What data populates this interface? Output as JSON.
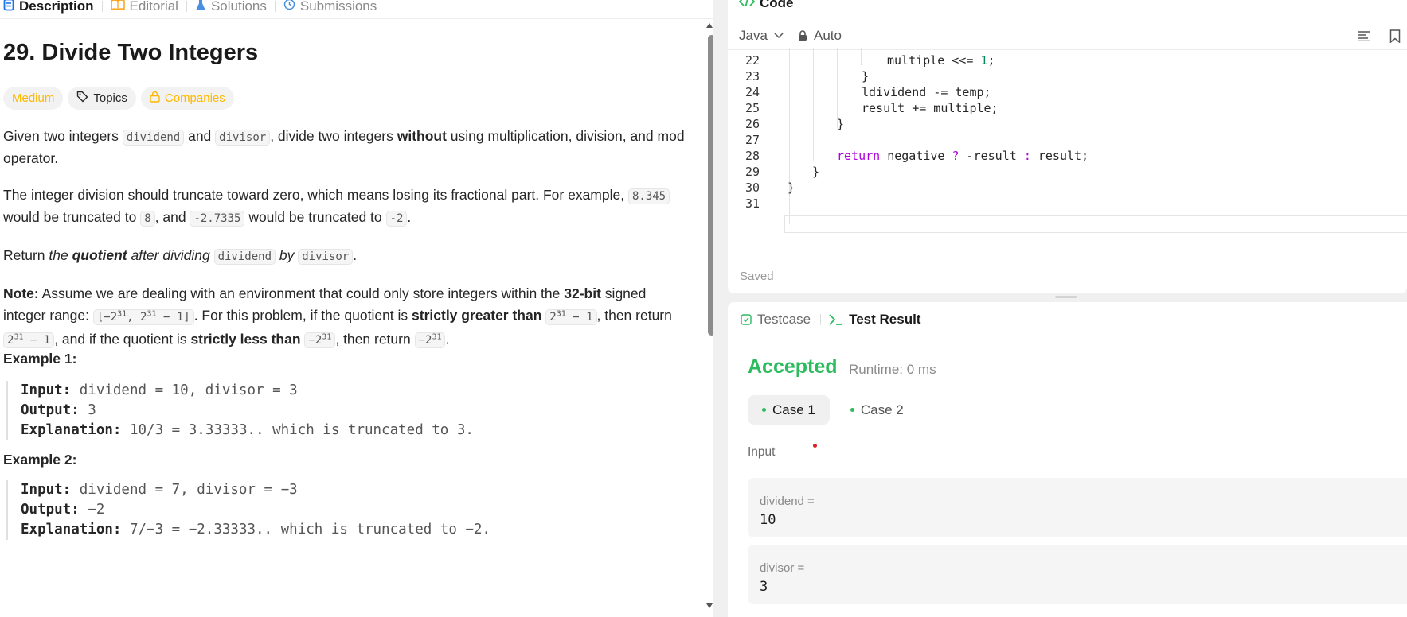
{
  "left_tabs": [
    {
      "label": "Description",
      "icon": "document-icon"
    },
    {
      "label": "Editorial",
      "icon": "book-icon"
    },
    {
      "label": "Solutions",
      "icon": "flask-icon"
    },
    {
      "label": "Submissions",
      "icon": "history-icon"
    }
  ],
  "problem": {
    "title": "29. Divide Two Integers",
    "difficulty": "Medium",
    "topics": "Topics",
    "companies": "Companies",
    "difficulty_color": "#ffb800"
  },
  "desc": {
    "p1": {
      "a": "Given two integers ",
      "c1": "dividend",
      "b": " and ",
      "c2": "divisor",
      "d": ", divide two integers ",
      "bold": "without",
      "e": " using multiplication, division, and mod operator."
    },
    "p2": {
      "a": "The integer division should truncate toward zero, which means losing its fractional part. For example, ",
      "c1": "8.345",
      "b": " would be truncated to ",
      "c2": "8",
      "d": ", and ",
      "c3": "-2.7335",
      "e": " would be truncated to ",
      "c4": "-2",
      "f": "."
    },
    "p3": {
      "a": "Return ",
      "i1": "the ",
      "bi": "quotient",
      "i2": " after dividing ",
      "c1": "dividend",
      "i3": " by ",
      "c2": "divisor",
      "f": "."
    },
    "p4": {
      "note": "Note:",
      "a": " Assume we are dealing with an environment that could only store integers within the ",
      "b32": "32-bit",
      "b": " signed integer range: ",
      "range_open": "[−2",
      "exp": "31",
      "range_mid": ", 2",
      "range_close": " − 1]",
      "c": ". For this problem, if the quotient is ",
      "sg": "strictly greater than",
      "two": "2",
      "minus_one": " − 1",
      "d": ", then return ",
      "e": ", and if the quotient is ",
      "sl": "strictly less than",
      "neg_two": "−2",
      "f": ", then return ",
      "end": "."
    }
  },
  "examples": [
    {
      "heading": "Example 1:",
      "input_k": "Input:",
      "input_v": " dividend = 10, divisor = 3",
      "output_k": "Output:",
      "output_v": " 3",
      "expl_k": "Explanation:",
      "expl_v": " 10/3 = 3.33333.. which is truncated to 3."
    },
    {
      "heading": "Example 2:",
      "input_k": "Input:",
      "input_v": " dividend = 7, divisor = −3",
      "output_k": "Output:",
      "output_v": " −2",
      "expl_k": "Explanation:",
      "expl_v": " 7/−3 = −2.33333.. which is truncated to −2."
    }
  ],
  "code": {
    "header": "Code",
    "language": "Java",
    "auto": "Auto",
    "saved": "Saved",
    "line_numbers": [
      "22",
      "23",
      "24",
      "25",
      "26",
      "27",
      "28",
      "29",
      "30",
      "31"
    ],
    "lines": [
      {
        "plain": "multiple <<= ",
        "num": "1",
        "tail": ";"
      },
      {
        "plain": "}"
      },
      {
        "plain": "ldividend -= temp;"
      },
      {
        "plain": "result += multiple;"
      },
      {
        "plain": "}"
      },
      {
        "plain": ""
      },
      {
        "kw": "return",
        "plain": " negative ",
        "kw2": "?",
        "plain2": " -result ",
        "kw3": ":",
        "plain3": " result;"
      },
      {
        "plain": "}"
      },
      {
        "plain": "}"
      },
      {
        "plain": ""
      }
    ]
  },
  "result": {
    "tab_testcase": "Testcase",
    "tab_result": "Test Result",
    "status": "Accepted",
    "runtime": "Runtime: 0 ms",
    "cases": [
      "Case 1",
      "Case 2"
    ],
    "input_label": "Input",
    "inputs": [
      {
        "key": "dividend =",
        "value": "10"
      },
      {
        "key": "divisor =",
        "value": "3"
      }
    ],
    "accent": "#2cbb5d"
  }
}
